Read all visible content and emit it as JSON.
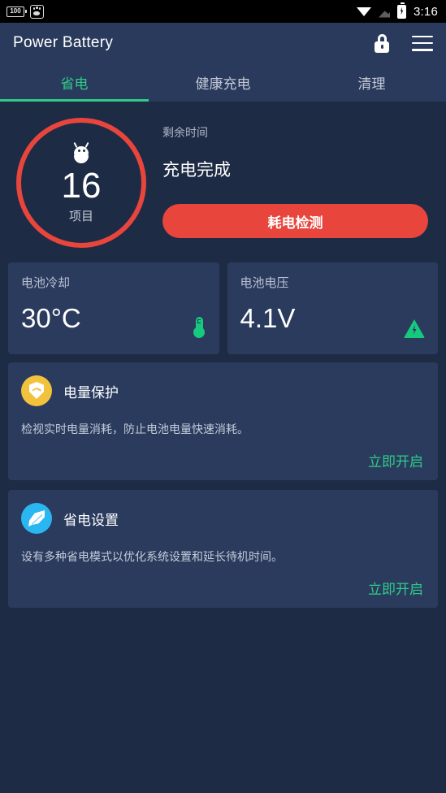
{
  "statusbar": {
    "battery_level_icon_text": "100",
    "icons": [
      "battery-level-icon",
      "baidu-paw-icon",
      "wifi-icon",
      "signal-icon",
      "charging-battery-icon"
    ],
    "time": "3:16"
  },
  "appbar": {
    "title": "Power Battery",
    "lock_icon": "lock-icon",
    "menu_icon": "hamburger-menu-icon"
  },
  "tabs": [
    {
      "label": "省电",
      "active": true
    },
    {
      "label": "健康充电",
      "active": false
    },
    {
      "label": "清理",
      "active": false
    }
  ],
  "hero": {
    "gauge": {
      "icon": "android-robot-icon",
      "value": "16",
      "label": "项目",
      "ring_color": "#e8453c"
    },
    "remaining_time_label": "剩余时间",
    "status": "充电完成",
    "cta_label": "耗电检测",
    "cta_color": "#e8453c"
  },
  "stats": [
    {
      "label": "电池冷却",
      "value": "30°C",
      "icon": "thermometer-icon",
      "icon_color": "#16c97e"
    },
    {
      "label": "电池电压",
      "value": "4.1V",
      "icon": "voltage-triangle-icon",
      "icon_color": "#16c97e"
    }
  ],
  "features": [
    {
      "title": "电量保护",
      "desc": "检视实时电量消耗，防止电池电量快速消耗。",
      "action": "立即开启",
      "icon": "shield-icon",
      "icon_bg": "#f2c23d"
    },
    {
      "title": "省电设置",
      "desc": "设有多种省电模式以优化系统设置和延长待机时间。",
      "action": "立即开启",
      "icon": "leaf-icon",
      "icon_bg": "#2ab6f0"
    }
  ],
  "theme": {
    "page_bg": "#1e2b45",
    "card_bg": "#2b3b5e",
    "appbar_bg": "#2a3a5c",
    "accent_green": "#2ecc87",
    "accent_red": "#e8453c"
  }
}
